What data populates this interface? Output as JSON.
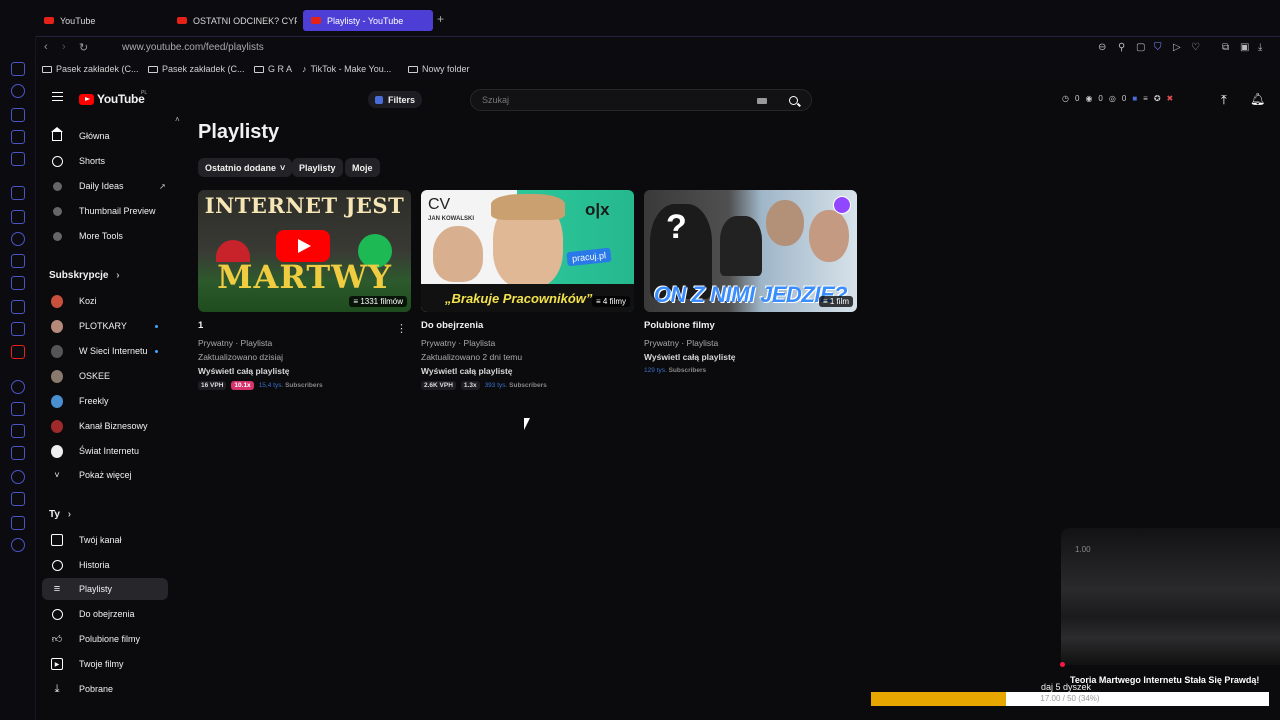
{
  "browser": {
    "tabs": [
      {
        "label": "YouTube"
      },
      {
        "label": "OSTATNI ODCINEK? CYPE"
      },
      {
        "label": "Playlisty - YouTube"
      }
    ],
    "url": "www.youtube.com/feed/playlists",
    "bookmarks": [
      {
        "label": "Pasek zakładek (C..."
      },
      {
        "label": "Pasek zakładek (C..."
      },
      {
        "label": "G R A"
      },
      {
        "label": "TikTok - Make You..."
      },
      {
        "label": "Nowy folder"
      }
    ]
  },
  "masthead": {
    "logo_text": "YouTube",
    "logo_region": "PL",
    "filters_label": "Filters",
    "search_placeholder": "Szukaj",
    "stats": [
      "0",
      "0",
      "0"
    ]
  },
  "sidebar": {
    "main": [
      {
        "label": "Główna"
      },
      {
        "label": "Shorts"
      },
      {
        "label": "Daily Ideas"
      },
      {
        "label": "Thumbnail Preview"
      },
      {
        "label": "More Tools"
      }
    ],
    "subs_heading": "Subskrypcje",
    "subscriptions": [
      {
        "label": "Kozi",
        "color": "#c9503d"
      },
      {
        "label": "PLOTKARY",
        "color": "#b58a7a"
      },
      {
        "label": "W Sieci Internetu",
        "color": "#555555"
      },
      {
        "label": "OSKEE",
        "color": "#8a7a6e"
      },
      {
        "label": "Freekly",
        "color": "#4a8fd0"
      },
      {
        "label": "Kanał Biznesowy",
        "color": "#a02a2a"
      },
      {
        "label": "Świat Internetu",
        "color": "#eeeeee"
      }
    ],
    "show_more": "Pokaż więcej",
    "you_heading": "Ty",
    "you": [
      {
        "label": "Twój kanał"
      },
      {
        "label": "Historia"
      },
      {
        "label": "Playlisty"
      },
      {
        "label": "Do obejrzenia"
      },
      {
        "label": "Polubione filmy"
      },
      {
        "label": "Twoje filmy"
      },
      {
        "label": "Pobrane"
      }
    ]
  },
  "main": {
    "title": "Playlisty",
    "chips": [
      "Ostatnio dodane",
      "Playlisty",
      "Moje"
    ],
    "playlists": [
      {
        "thumb_text_top": "INTERNET JEST",
        "thumb_text_bottom": "MARTWY",
        "count": "1331 filmów",
        "title": "1",
        "privacy": "Prywatny",
        "type": "Playlista",
        "updated": "Zaktualizowano dzisiaj",
        "link": "Wyświetl całą playlistę",
        "vph": "16 VPH",
        "mult": "10.1x",
        "subs_num": "15,4 tys.",
        "subs_label": "Subscribers"
      },
      {
        "thumb_cv": "CV",
        "thumb_name": "JAN KOWALSKI",
        "thumb_brand": "o|x",
        "thumb_pill": "pracuj.pl",
        "thumb_caption": "„Brakuje Pracowników”",
        "count": "4 filmy",
        "title": "Do obejrzenia",
        "privacy": "Prywatny",
        "type": "Playlista",
        "updated": "Zaktualizowano 2 dni temu",
        "link": "Wyświetl całą playlistę",
        "vph": "2.6K VPH",
        "mult": "1.3x",
        "subs_num": "393 tys.",
        "subs_label": "Subscribers"
      },
      {
        "thumb_q": "?",
        "thumb_caption": "ON Z NIMI JEDZIE?",
        "count": "1 film",
        "title": "Polubione filmy",
        "privacy": "Prywatny",
        "type": "Playlista",
        "link": "Wyświetl całą playlistę",
        "subs_num": "129 tys.",
        "subs_label": "Subscribers"
      }
    ]
  },
  "overlay": {
    "version": "1.00",
    "title": "Teoria Martwego Internetu Stała Się Prawdą!",
    "subtitle": "daj 5 dyszek",
    "progress_text": "17.00 / 50 (34%)",
    "progress_fraction": 0.34,
    "progress_color": "#e8a700"
  }
}
